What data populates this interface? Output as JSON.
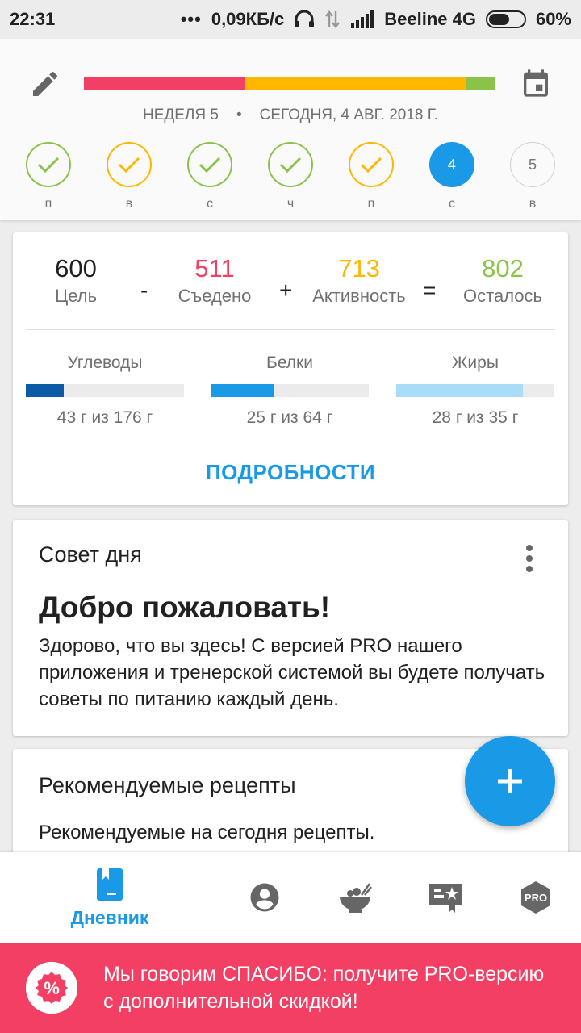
{
  "status_bar": {
    "time": "22:31",
    "dots": "•••",
    "speed": "0,09КБ/с",
    "carrier": "Beeline 4G",
    "battery": "60%",
    "battery_level": 0.6
  },
  "header": {
    "progress_segments": [
      {
        "color": "#f33f63",
        "fraction": 0.39
      },
      {
        "color": "#ffb700",
        "fraction": 0.54
      },
      {
        "color": "#8bc34a",
        "fraction": 0.07
      }
    ],
    "week": "НЕДЕЛЯ 5",
    "separator": "•",
    "date": "СЕГОДНЯ, 4 АВГ. 2018 Г.",
    "days": [
      {
        "label": "п",
        "state": "done-green",
        "text": ""
      },
      {
        "label": "в",
        "state": "done-yellow",
        "text": ""
      },
      {
        "label": "с",
        "state": "done-green",
        "text": ""
      },
      {
        "label": "ч",
        "state": "done-green",
        "text": ""
      },
      {
        "label": "п",
        "state": "done-yellow",
        "text": ""
      },
      {
        "label": "с",
        "state": "today",
        "text": "4"
      },
      {
        "label": "в",
        "state": "future",
        "text": "5"
      }
    ]
  },
  "summary": {
    "goal": {
      "value": "600",
      "caption": "Цель",
      "color": "#212121"
    },
    "minus": "-",
    "eaten": {
      "value": "511",
      "caption": "Съедено",
      "color": "#f33f63"
    },
    "plus": "+",
    "activity": {
      "value": "713",
      "caption": "Активность",
      "color": "#ffb700"
    },
    "equals": "=",
    "left": {
      "value": "802",
      "caption": "Осталось",
      "color": "#8bc34a"
    },
    "macros": [
      {
        "name": "Углеводы",
        "value": "43 г из 176 г",
        "fraction": 0.24,
        "color": "#0d5aa7"
      },
      {
        "name": "Белки",
        "value": "25 г из 64 г",
        "fraction": 0.4,
        "color": "#1a9ae6"
      },
      {
        "name": "Жиры",
        "value": "28 г из 35 г",
        "fraction": 0.8,
        "color": "#a8dcf7"
      }
    ],
    "details_label": "ПОДРОБНОСТИ"
  },
  "tip": {
    "title": "Совет дня",
    "heading": "Добро пожаловать!",
    "body": "Здорово, что вы здесь! С версией PRO нашего приложения и тренерской системой вы будете получать советы по питанию каждый день."
  },
  "recipes": {
    "title": "Рекомендуемые рецепты",
    "subtitle": "Рекомендуемые на сегодня рецепты."
  },
  "bottom_nav": {
    "items": [
      {
        "icon": "diary-icon",
        "label": "Дневник",
        "active": true
      },
      {
        "icon": "profile-icon",
        "label": ""
      },
      {
        "icon": "recipes-bowl-icon",
        "label": ""
      },
      {
        "icon": "plans-icon",
        "label": ""
      },
      {
        "icon": "pro-icon",
        "label": "PRO"
      }
    ]
  },
  "promo": {
    "text": "Мы говорим СПАСИБО: получите PRO-версию с дополнительной скидкой!",
    "badge_text": "%"
  }
}
